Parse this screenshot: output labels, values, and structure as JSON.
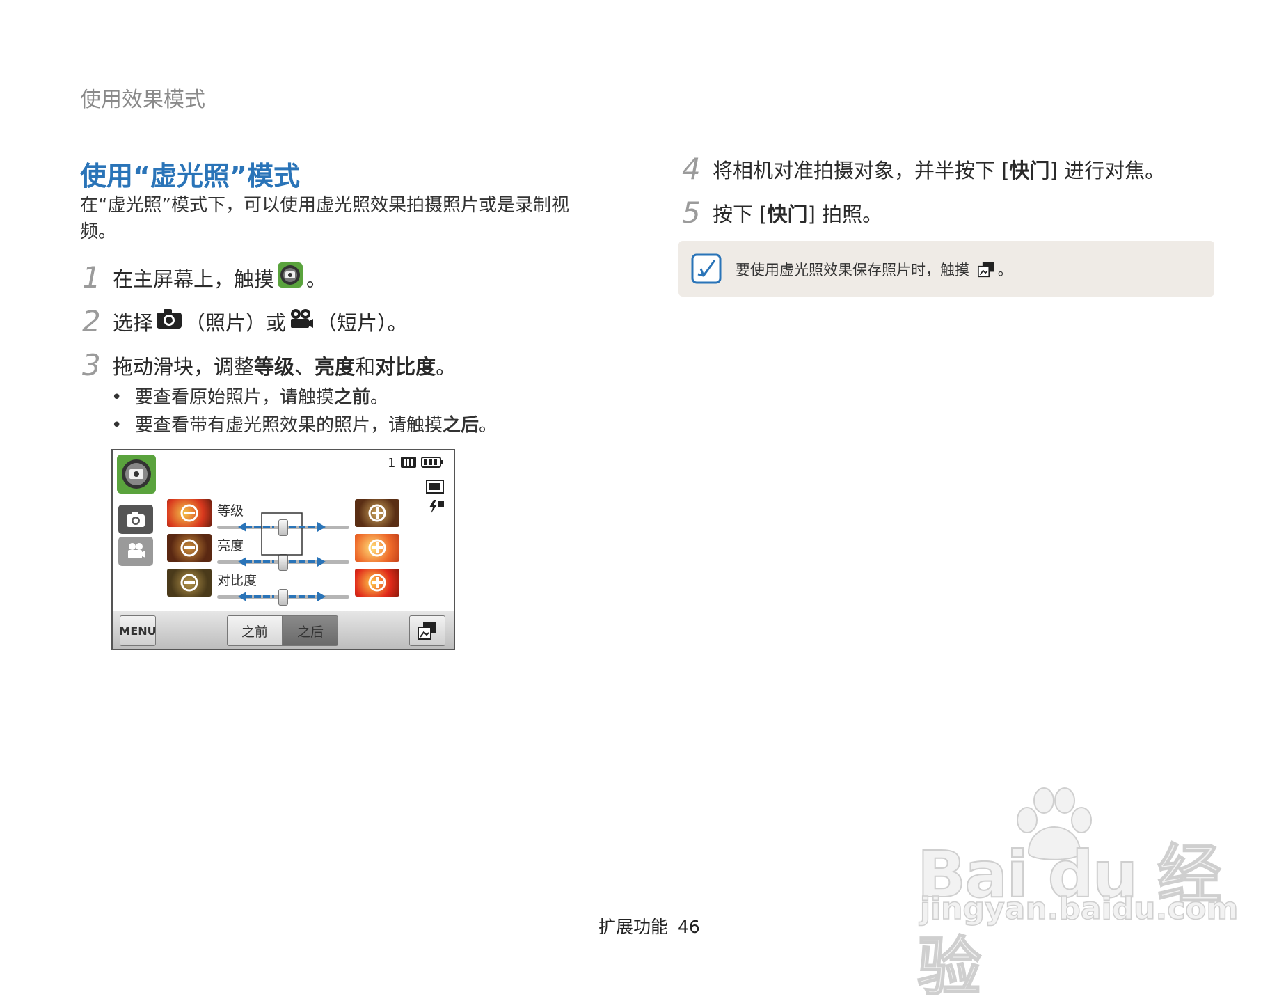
{
  "header": {
    "title": "使用效果模式"
  },
  "section": {
    "title": "使用“虚光照”模式",
    "intro": "在“虚光照”模式下，可以使用虚光照效果拍摄照片或是录制视频。"
  },
  "steps": [
    {
      "num": "1",
      "a": "在主屏幕上，触摸",
      "b": "。"
    },
    {
      "num": "2",
      "a": "选择",
      "b": "（照片）或",
      "c": "（短片）。"
    },
    {
      "num": "3",
      "a": "拖动滑块，调整",
      "b1": "等级",
      "s1": "、",
      "b2": "亮度",
      "s2": "和",
      "b3": "对比度",
      "end": "。"
    },
    {
      "num": "4",
      "a": "将相机对准拍摄对象，并半按下 [",
      "b": "快门",
      "c": "] 进行对焦。"
    },
    {
      "num": "5",
      "a": "按下 [",
      "b": "快门",
      "c": "] 拍照。"
    }
  ],
  "bullets": [
    {
      "a": "要查看原始照片，请触摸",
      "b": "之前",
      "c": "。"
    },
    {
      "a": "要查看带有虚光照效果的照片，请触摸",
      "b": "之后",
      "c": "。"
    }
  ],
  "camera_screen": {
    "shot_count": "1",
    "sliders": [
      {
        "label": "等级",
        "level": 0.5
      },
      {
        "label": "亮度",
        "level": 0.5
      },
      {
        "label": "对比度",
        "level": 0.5
      }
    ],
    "menu_label": "MENU",
    "before_label": "之前",
    "after_label": "之后",
    "accent_green": "#5aa33d",
    "accent_blue": "#2a74b8"
  },
  "note": {
    "text": "要使用虚光照效果保存照片时，触摸",
    "end": "。"
  },
  "footer": {
    "section": "扩展功能",
    "page": "46"
  },
  "watermark": {
    "logo": "Bai du 经验",
    "sub": "jingyan.baidu.com"
  }
}
